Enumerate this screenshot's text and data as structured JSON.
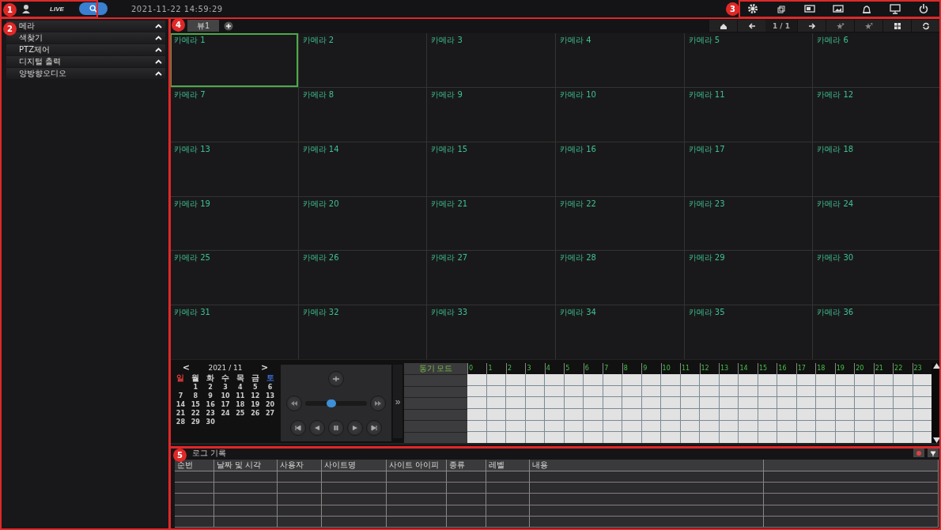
{
  "top_bar": {
    "live_label": "LIVE",
    "modes": [
      {
        "kind": "live",
        "selected": false
      },
      {
        "kind": "search",
        "selected": true
      }
    ],
    "datetime": "2021-11-22 14:59:29"
  },
  "sidebar": {
    "items": [
      {
        "label": "메라",
        "expanded": true
      },
      {
        "label": "색찾기",
        "expanded": true
      },
      {
        "label": "PTZ제어",
        "expanded": true
      },
      {
        "label": "디지털 출력",
        "expanded": true
      },
      {
        "label": "양방향오디오",
        "expanded": true
      }
    ]
  },
  "viewer": {
    "tabs": [
      {
        "label": "뷰1",
        "selected": true
      }
    ],
    "page": "1 / 1",
    "cells": [
      {
        "label": "카메라 1",
        "selected": true
      },
      {
        "label": "카메라 2",
        "selected": false
      },
      {
        "label": "카메라 3",
        "selected": false
      },
      {
        "label": "카메라 4",
        "selected": false
      },
      {
        "label": "카메라 5",
        "selected": false
      },
      {
        "label": "카메라 6",
        "selected": false
      },
      {
        "label": "카메라 7",
        "selected": false
      },
      {
        "label": "카메라 8",
        "selected": false
      },
      {
        "label": "카메라 9",
        "selected": false
      },
      {
        "label": "카메라 10",
        "selected": false
      },
      {
        "label": "카메라 11",
        "selected": false
      },
      {
        "label": "카메라 12",
        "selected": false
      },
      {
        "label": "카메라 13",
        "selected": false
      },
      {
        "label": "카메라 14",
        "selected": false
      },
      {
        "label": "카메라 15",
        "selected": false
      },
      {
        "label": "카메라 16",
        "selected": false
      },
      {
        "label": "카메라 17",
        "selected": false
      },
      {
        "label": "카메라 18",
        "selected": false
      },
      {
        "label": "카메라 19",
        "selected": false
      },
      {
        "label": "카메라 20",
        "selected": false
      },
      {
        "label": "카메라 21",
        "selected": false
      },
      {
        "label": "카메라 22",
        "selected": false
      },
      {
        "label": "카메라 23",
        "selected": false
      },
      {
        "label": "카메라 24",
        "selected": false
      },
      {
        "label": "카메라 25",
        "selected": false
      },
      {
        "label": "카메라 26",
        "selected": false
      },
      {
        "label": "카메라 27",
        "selected": false
      },
      {
        "label": "카메라 28",
        "selected": false
      },
      {
        "label": "카메라 29",
        "selected": false
      },
      {
        "label": "카메라 30",
        "selected": false
      },
      {
        "label": "카메라 31",
        "selected": false
      },
      {
        "label": "카메라 32",
        "selected": false
      },
      {
        "label": "카메라 33",
        "selected": false
      },
      {
        "label": "카메라 34",
        "selected": false
      },
      {
        "label": "카메라 35",
        "selected": false
      },
      {
        "label": "카메라 36",
        "selected": false
      }
    ]
  },
  "calendar": {
    "prev": "<",
    "month": "2021 / 11",
    "next": ">",
    "weekdays": [
      {
        "label": "일",
        "color": "#e03a3a"
      },
      {
        "label": "월",
        "color": "#cfcfcf"
      },
      {
        "label": "화",
        "color": "#cfcfcf"
      },
      {
        "label": "수",
        "color": "#cfcfcf"
      },
      {
        "label": "목",
        "color": "#cfcfcf"
      },
      {
        "label": "금",
        "color": "#cfcfcf"
      },
      {
        "label": "토",
        "color": "#3a6fd8"
      }
    ],
    "weeks": [
      [
        "1",
        "2",
        "3",
        "4",
        "5",
        "6"
      ],
      [
        "7",
        "8",
        "9",
        "10",
        "11",
        "12",
        "13"
      ],
      [
        "14",
        "15",
        "16",
        "17",
        "18",
        "19",
        "20"
      ],
      [
        "21",
        "22",
        "23",
        "24",
        "25",
        "26",
        "27"
      ],
      [
        "28",
        "29",
        "30"
      ]
    ]
  },
  "playback": {
    "slider": {
      "level": 0.42
    },
    "expand": "»"
  },
  "timeline": {
    "sync_mode": "동기 모드",
    "hours": [
      "0",
      "1",
      "2",
      "3",
      "4",
      "5",
      "6",
      "7",
      "8",
      "9",
      "10",
      "11",
      "12",
      "13",
      "14",
      "15",
      "16",
      "17",
      "18",
      "19",
      "20",
      "21",
      "22",
      "23"
    ]
  },
  "log": {
    "title": "로그 기록",
    "columns": [
      "순번",
      "날짜 및 시각",
      "사용자",
      "사이트명",
      "사이트 아이피",
      "종류",
      "레벨",
      "내용"
    ]
  },
  "annotations": [
    {
      "label": "1"
    },
    {
      "label": "2"
    },
    {
      "label": "3"
    },
    {
      "label": "4"
    },
    {
      "label": "5"
    }
  ]
}
